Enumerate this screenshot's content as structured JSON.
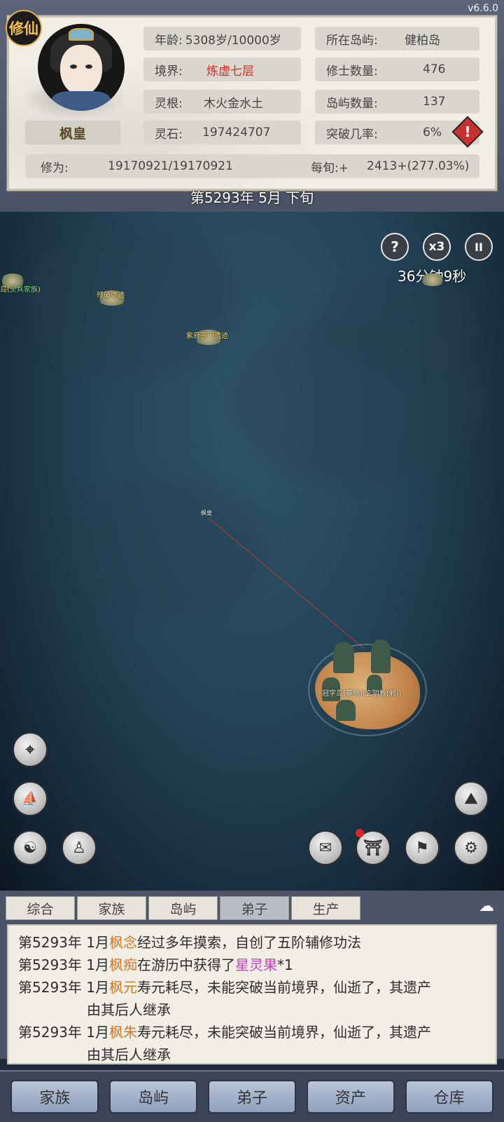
{
  "version": "v6.6.0",
  "header": {
    "badge": "修仙",
    "name": "枫皇",
    "stats_left": [
      {
        "k": "年龄:",
        "v": "5308岁/10000岁"
      },
      {
        "k": "境界:",
        "v": "炼虚七层"
      },
      {
        "k": "灵根:",
        "v": "木火金水土"
      },
      {
        "k": "灵石:",
        "v": "197424707"
      }
    ],
    "stats_right": [
      {
        "k": "所在岛屿:",
        "v": "健柏岛"
      },
      {
        "k": "修士数量:",
        "v": "476"
      },
      {
        "k": "岛屿数量:",
        "v": "137"
      },
      {
        "k": "突破几率:",
        "v": "6%"
      }
    ],
    "cultivation_label": "修为:",
    "cultivation_value": "19170921/19170921",
    "per_turn_label": "每旬:+",
    "per_turn_value": "2413+(277.03%)",
    "realm_color": "#d0302a"
  },
  "date": "第5293年 5月 下旬",
  "map": {
    "controls": {
      "help": "?",
      "speed": "x3",
      "pause": "II"
    },
    "timer": "36分钟9秒",
    "labels": {
      "left_island": "岛(",
      "left_island_green": "灵兵家族",
      "left_island_end": ")",
      "ruins1": "残破遗迹",
      "ruins2": "紫府宗门遗迹",
      "player_marker": "枫皇",
      "big_island": "冠字岛(基地)(玄阴教(邪))"
    }
  },
  "log": {
    "tabs": [
      "综合",
      "家族",
      "岛屿",
      "弟子",
      "生产"
    ],
    "active_tab": 3,
    "entries": [
      {
        "prefix": "第5293年 1月",
        "name": "枫念",
        "text": "经过多年摸索，自创了五阶辅修功法"
      },
      {
        "prefix": "第5293年 1月",
        "name": "枫痴",
        "text": "在游历中获得了",
        "item": "星灵果",
        "suffix": "*1"
      },
      {
        "prefix": "第5293年 1月",
        "name": "枫元",
        "text": "寿元耗尽，未能突破当前境界，仙逝了，其遗产",
        "wrap": "由其后人继承"
      },
      {
        "prefix": "第5293年 1月",
        "name": "枫朱",
        "text": "寿元耗尽，未能突破当前境界，仙逝了，其遗产",
        "wrap": "由其后人继承"
      }
    ]
  },
  "nav": [
    "家族",
    "岛屿",
    "弟子",
    "资产",
    "仓库"
  ]
}
